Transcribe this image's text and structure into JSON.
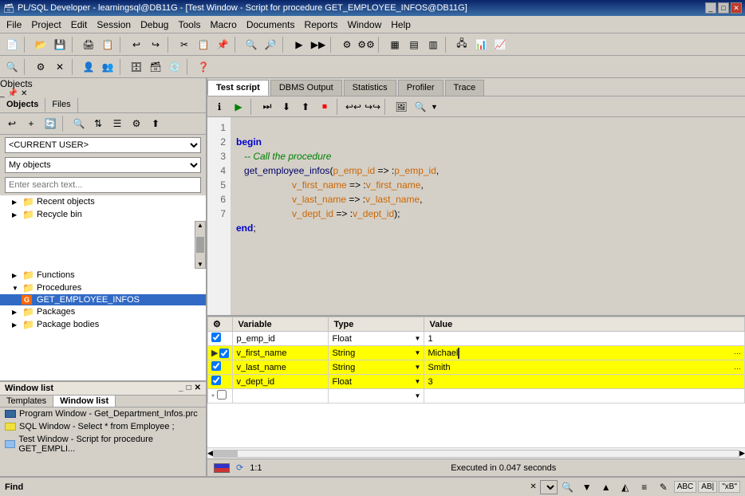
{
  "titlebar": {
    "title": "PL/SQL Developer - learningsql@DB11G - [Test Window - Script for procedure GET_EMPLOYEE_INFOS@DB11G]",
    "icon": "🗃"
  },
  "menubar": {
    "items": [
      "File",
      "Project",
      "Edit",
      "Session",
      "Debug",
      "Tools",
      "Macro",
      "Documents",
      "Reports",
      "Window",
      "Help"
    ]
  },
  "left_panel": {
    "title": "Objects",
    "tabs": [
      "Objects",
      "Files"
    ],
    "schema_value": "<CURRENT USER>",
    "filter_value": "My objects",
    "search_placeholder": "Enter search text...",
    "tree": [
      {
        "label": "Recent objects",
        "level": 1,
        "type": "folder",
        "expanded": false
      },
      {
        "label": "Recycle bin",
        "level": 1,
        "type": "folder",
        "expanded": false
      },
      {
        "label": "Functions",
        "level": 1,
        "type": "folder",
        "expanded": false
      },
      {
        "label": "Procedures",
        "level": 1,
        "type": "folder",
        "expanded": true
      },
      {
        "label": "GET_EMPLOYEE_INFOS",
        "level": 2,
        "type": "procedure",
        "expanded": false,
        "selected": true
      },
      {
        "label": "Packages",
        "level": 1,
        "type": "folder",
        "expanded": false
      },
      {
        "label": "Package bodies",
        "level": 1,
        "type": "folder",
        "expanded": false
      }
    ]
  },
  "window_list": {
    "title": "Window list",
    "tabs": [
      "Templates",
      "Window list"
    ],
    "items": [
      {
        "label": "Program Window - Get_Department_Infos.prc",
        "type": "prog"
      },
      {
        "label": "SQL Window - Select * from Employee ;",
        "type": "sql"
      },
      {
        "label": "Test Window - Script for procedure GET_EMPLI...",
        "type": "test"
      }
    ]
  },
  "right_panel": {
    "tabs": [
      "Test script",
      "DBMS Output",
      "Statistics",
      "Profiler",
      "Trace"
    ],
    "active_tab": "Test script"
  },
  "editor": {
    "lines": [
      1,
      2,
      3,
      4,
      5,
      6,
      7
    ],
    "code_lines": [
      {
        "num": 1,
        "text": "begin"
      },
      {
        "num": 2,
        "text": "   -- Call the procedure"
      },
      {
        "num": 3,
        "text": "   get_employee_infos(p_emp_id => :p_emp_id,"
      },
      {
        "num": 4,
        "text": "                     v_first_name => :v_first_name,"
      },
      {
        "num": 5,
        "text": "                     v_last_name => :v_last_name,"
      },
      {
        "num": 6,
        "text": "                     v_dept_id => :v_dept_id);"
      },
      {
        "num": 7,
        "text": "end;"
      }
    ]
  },
  "variables": {
    "columns": [
      "",
      "Variable",
      "Type",
      "Value"
    ],
    "rows": [
      {
        "indicator": "",
        "check": true,
        "variable": "p_emp_id",
        "type": "Float",
        "value": "1",
        "highlight": false
      },
      {
        "indicator": "▶",
        "check": true,
        "variable": "v_first_name",
        "type": "String",
        "value": "Michael",
        "highlight": true
      },
      {
        "indicator": "",
        "check": true,
        "variable": "v_last_name",
        "type": "String",
        "value": "Smith",
        "highlight": true
      },
      {
        "indicator": "",
        "check": true,
        "variable": "v_dept_id",
        "type": "Float",
        "value": "3",
        "highlight": true
      }
    ]
  },
  "status_bar": {
    "position": "1:1",
    "message": "Executed in 0.047 seconds"
  },
  "find_bar": {
    "label": "Find",
    "buttons": [
      "▼",
      "▲",
      "◭",
      "≡",
      "✎",
      "ABC",
      "AB|",
      "\"xB\""
    ]
  }
}
